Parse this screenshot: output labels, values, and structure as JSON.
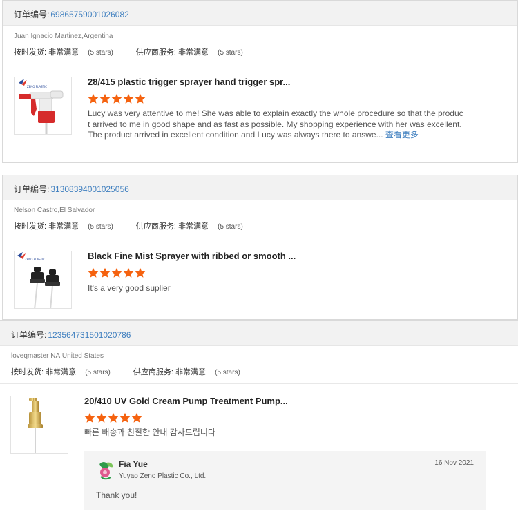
{
  "reviews": [
    {
      "order_label": "订单编号:",
      "order_number": "69865759001026082",
      "buyer": "Juan Ignacio Martinez,Argentina",
      "delivery_label": "按时发货:",
      "delivery_value": "非常满意",
      "delivery_stars": "(5 stars)",
      "service_label": "供应商服务:",
      "service_value": "非常满意",
      "service_stars": "(5 stars)",
      "product_title": "28/415 plastic trigger sprayer hand trigger spr...",
      "rating": 5,
      "text": "Lucy was very attentive to me! She was able to explain exactly the whole procedure so that the product arrived to me in good shape and as fast as possible. My shopping experience with her was excellent. The product arrived in excellent condition and Lucy was always there to answe...",
      "more_label": "查看更多"
    },
    {
      "order_label": "订单编号:",
      "order_number": "31308394001025056",
      "buyer": "Nelson Castro,El Salvador",
      "delivery_label": "按时发货:",
      "delivery_value": "非常满意",
      "delivery_stars": "(5 stars)",
      "service_label": "供应商服务:",
      "service_value": "非常满意",
      "service_stars": "(5 stars)",
      "product_title": "Black Fine Mist Sprayer with ribbed or smooth ...",
      "rating": 5,
      "text": "It's a very good suplier"
    },
    {
      "order_label": "订单编号:",
      "order_number": "123564731501020786",
      "buyer": "loveqmaster NA,United States",
      "delivery_label": "按时发货:",
      "delivery_value": "非常满意",
      "delivery_stars": "(5 stars)",
      "service_label": "供应商服务:",
      "service_value": "非常满意",
      "service_stars": "(5 stars)",
      "product_title": "20/410 UV Gold Cream Pump Treatment Pump...",
      "rating": 5,
      "text": "빠른 배송과 친절한 안내 감사드립니다",
      "reply": {
        "name": "Fia Yue",
        "company": "Yuyao Zeno Plastic Co., Ltd.",
        "date": "16 Nov 2021",
        "message": "Thank you!"
      }
    }
  ],
  "icons": {
    "star": "star-icon",
    "trigger_sprayer": "trigger-sprayer-image",
    "mist_sprayer": "mist-sprayer-image",
    "cream_pump": "cream-pump-image"
  },
  "colors": {
    "star": "#f5620f",
    "link": "#3f7fbf"
  }
}
